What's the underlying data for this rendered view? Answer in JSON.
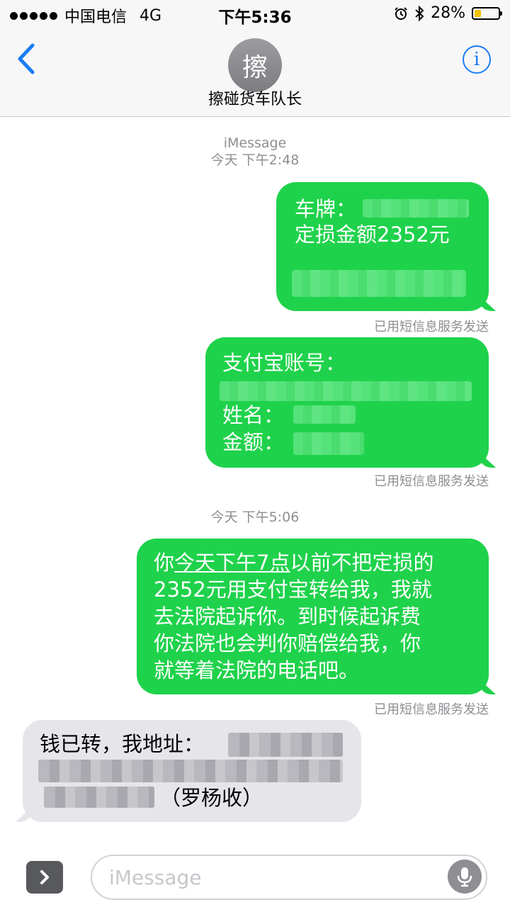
{
  "status_bar": {
    "carrier": "中国电信",
    "network": "4G",
    "time": "下午5:36",
    "battery_percent": "28%",
    "battery_level": 0.28
  },
  "nav": {
    "avatar_letter": "擦",
    "contact_name": "擦碰货车队长",
    "info_label": "i"
  },
  "thread": {
    "service_label": "iMessage",
    "timestamp_1": "今天 下午2:48",
    "timestamp_2": "今天 下午5:06",
    "delivered_label": "已用短信息服务发送",
    "messages": [
      {
        "from": "me",
        "line1": "车牌：",
        "line2": "定损金额2352元"
      },
      {
        "from": "me",
        "line1": "支付宝账号：",
        "line2": "姓名：",
        "line3": "金额："
      },
      {
        "from": "me",
        "line1_pre": "你",
        "line1_link": "今天下午7点",
        "line1_post": "以前不把定损的",
        "line2": "2352元用支付宝转给我，我就",
        "line3": "去法院起诉你。到时候起诉费",
        "line4": "你法院也会判你赔偿给我，你",
        "line5": "就等着法院的电话吧。"
      },
      {
        "from": "them",
        "line1": "钱已转，我地址：",
        "line3": "（罗杨收）"
      }
    ]
  },
  "composer": {
    "placeholder": "iMessage"
  },
  "icons": [
    "back-chevron-icon",
    "info-icon",
    "app-drawer-chevron-icon",
    "microphone-icon",
    "alarm-icon",
    "bluetooth-icon",
    "battery-icon",
    "signal-dots-icon"
  ]
}
